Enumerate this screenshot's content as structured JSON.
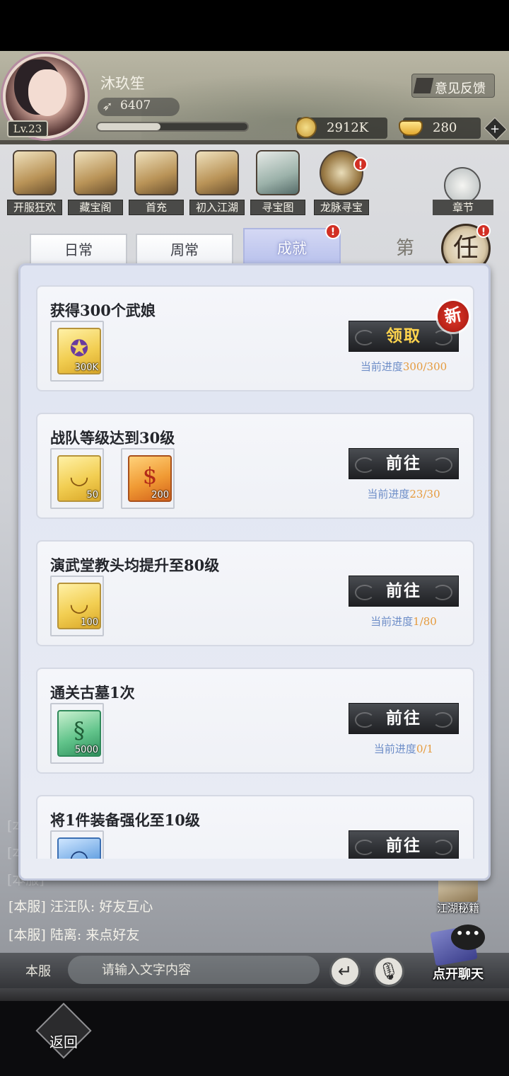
{
  "header": {
    "player_name": "沐玖笙",
    "level": "Lv.23",
    "power": "6407",
    "exp_fraction": 0.42,
    "feedback_label": "意见反馈",
    "coins": "2912K",
    "gold": "280",
    "plus_icon": "plus-icon"
  },
  "features": [
    {
      "label": "开服狂欢",
      "has_alert": false
    },
    {
      "label": "藏宝阁",
      "has_alert": false
    },
    {
      "label": "首充",
      "has_alert": false
    },
    {
      "label": "初入江湖",
      "has_alert": false
    },
    {
      "label": "寻宝图",
      "has_alert": false
    },
    {
      "label": "龙脉寻宝",
      "has_alert": true
    }
  ],
  "chapter_label": "章节",
  "task_glyph": "任",
  "edge_glyph": "第",
  "alert_mark": "!",
  "tabs": [
    {
      "label": "日常",
      "active": false
    },
    {
      "label": "周常",
      "active": false
    },
    {
      "label": "成就",
      "active": true
    }
  ],
  "progress_prefix": "当前进度",
  "achievements": [
    {
      "title": "获得300个武娘",
      "rewards": [
        {
          "icon": "purple-medallion-icon",
          "qty": "300K",
          "color": "gold"
        }
      ],
      "button": "领取",
      "claimable": true,
      "is_new": true,
      "new_badge": "新",
      "progress": "300/300"
    },
    {
      "title": "战队等级达到30级",
      "rewards": [
        {
          "icon": "gold-ingot-icon",
          "qty": "50",
          "color": "gold"
        },
        {
          "icon": "vip-exp-icon",
          "qty": "200",
          "color": "orange"
        }
      ],
      "button": "前往",
      "claimable": false,
      "progress": "23/30"
    },
    {
      "title": "演武堂教头均提升至80级",
      "rewards": [
        {
          "icon": "gold-ingot-icon",
          "qty": "100",
          "color": "gold"
        }
      ],
      "button": "前往",
      "claimable": false,
      "progress": "1/80"
    },
    {
      "title": "通关古墓1次",
      "rewards": [
        {
          "icon": "jade-dragon-icon",
          "qty": "5000",
          "color": "green"
        }
      ],
      "button": "前往",
      "claimable": false,
      "progress": "0/1"
    },
    {
      "title": "将1件装备强化至10级",
      "rewards": [
        {
          "icon": "blue-stone-icon",
          "qty": "",
          "color": "blue"
        }
      ],
      "button": "前往",
      "claimable": false,
      "progress": ""
    }
  ],
  "chat": {
    "messages": [
      {
        "channel": "[本服]",
        "text": "汪汪队: 好友互心"
      },
      {
        "channel": "[本服]",
        "text": "陆离: 来点好友"
      }
    ],
    "faded_prefix": "[本服]",
    "channel": "本服",
    "input_placeholder": "请输入文字内容",
    "open_label": "点开聊天",
    "book_label": "江湖秘籍"
  },
  "back_label": "返回"
}
